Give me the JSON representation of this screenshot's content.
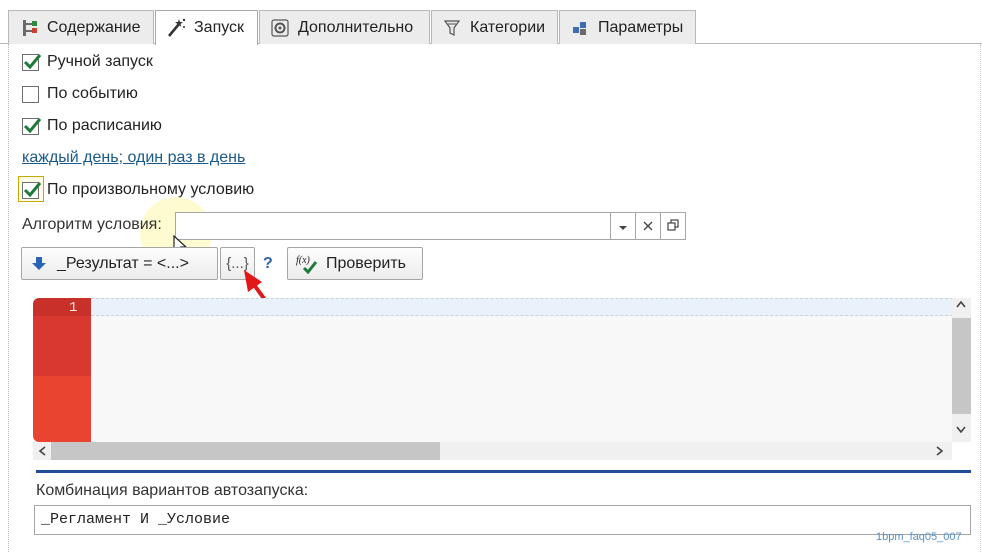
{
  "tabs": [
    {
      "label": "Содержание",
      "icon": "tree-icon"
    },
    {
      "label": "Запуск",
      "icon": "magic-wand-icon",
      "active": true
    },
    {
      "label": "Дополнительно",
      "icon": "gear-icon"
    },
    {
      "label": "Категории",
      "icon": "filter-icon"
    },
    {
      "label": "Параметры",
      "icon": "blocks-icon"
    }
  ],
  "launch": {
    "manual_label": "Ручной запуск",
    "manual_checked": true,
    "event_label": "По событию",
    "event_checked": false,
    "schedule_label": "По расписанию",
    "schedule_checked": true,
    "schedule_link": "каждый день; один раз в день",
    "condition_label": "По произвольному условию",
    "condition_checked": true
  },
  "algorithm": {
    "label": "Алгоритм условия:",
    "value": ""
  },
  "buttons": {
    "result_label": "_Результат = <...>",
    "braces_label": "{...}",
    "help_label": "?",
    "check_label": "Проверить"
  },
  "editor": {
    "line_number": "1"
  },
  "combination": {
    "label": "Комбинация вариантов автозапуска:",
    "value": "_Регламент И _Условие"
  },
  "watermark": "1bpm_faq05_007",
  "colors": {
    "accent_blue": "#1f4e96",
    "check_green": "#1e7a3a",
    "link": "#1a5a8a",
    "gutter_red": "#d8382f",
    "arrow_red": "#e01818"
  }
}
